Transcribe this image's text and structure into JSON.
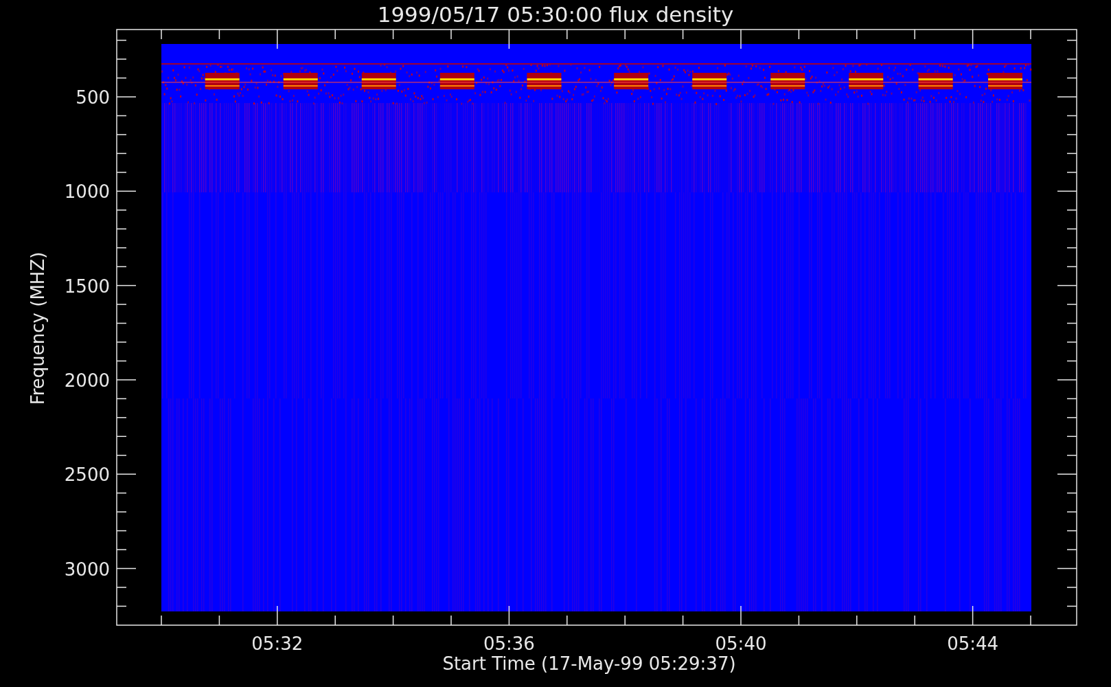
{
  "title": "1999/05/17 05:30:00 flux density",
  "y_axis": {
    "label": "Frequency (MHZ)",
    "ticks": [
      "500",
      "1000",
      "1500",
      "2000",
      "2500",
      "3000"
    ]
  },
  "x_axis": {
    "label": "Start Time (17-May-99 05:29:37)",
    "ticks": [
      "05:32",
      "05:36",
      "05:40",
      "05:44"
    ]
  }
}
